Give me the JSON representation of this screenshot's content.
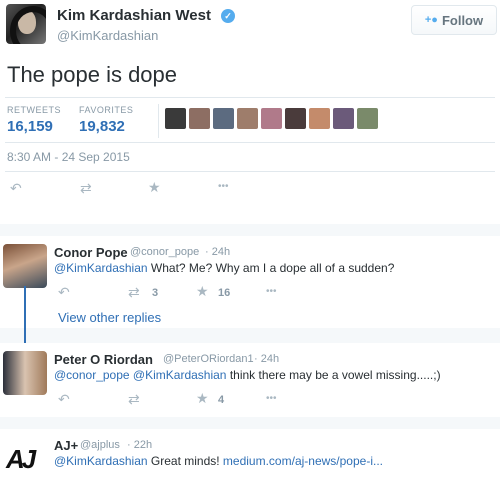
{
  "main_tweet": {
    "author_name": "Kim Kardashian West",
    "verified_icon": "verified-badge-icon",
    "handle": "@KimKardashian",
    "follow_label": "Follow",
    "text": "The pope is dope",
    "retweets_label": "RETWEETS",
    "retweets_value": "16,159",
    "favorites_label": "FAVORITES",
    "favorites_value": "19,832",
    "timestamp": "8:30 AM - 24 Sep 2015",
    "favoriter_avatar_colors": [
      "#3a3a3a",
      "#8d6e63",
      "#5c6b80",
      "#9e7d6b",
      "#b07a8a",
      "#4a3b3b",
      "#c48b6b",
      "#6b5a7a",
      "#7a8a6a"
    ]
  },
  "replies": [
    {
      "name": "Conor Pope",
      "handle": "@conor_pope",
      "time": "· 24h",
      "mention": "@KimKardashian",
      "text": " What? Me? Why am I a dope all of a sudden?",
      "retweets": "3",
      "favorites": "16"
    },
    {
      "name": "Peter O Riordan",
      "handle": "@PeterORiordan1",
      "time": "· 24h",
      "mention1": "@conor_pope",
      "mention2": "@KimKardashian",
      "text": " think there may be a vowel missing.....;)",
      "retweets": "",
      "favorites": "4"
    },
    {
      "name": "AJ+",
      "handle": "@ajplus",
      "time": "· 22h",
      "mention": "@KimKardashian",
      "text": " Great minds! ",
      "link": "medium.com/aj-news/pope-i..."
    }
  ],
  "view_other_replies": "View other replies",
  "icons": {
    "reply": "↶",
    "retweet": "⇄",
    "favorite": "★",
    "more": "•••"
  },
  "colors": {
    "accent": "#2f6fb5",
    "muted": "#8899a6",
    "icon": "#aab8c2"
  }
}
